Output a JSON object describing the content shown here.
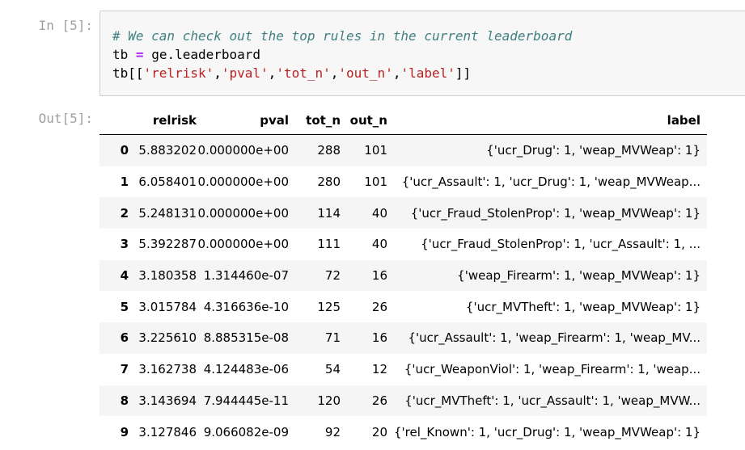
{
  "in_prompt": "In [5]:",
  "out_prompt": "Out[5]:",
  "code": {
    "comment": "# We can check out the top rules in the current leaderboard",
    "line2": {
      "var": "tb",
      "op": "=",
      "expr": "ge.leaderboard"
    },
    "line3": {
      "prefix": "tb[[",
      "s1": "'relrisk'",
      "s2": "'pval'",
      "s3": "'tot_n'",
      "s4": "'out_n'",
      "s5": "'label'",
      "comma": ",",
      "suffix": "]]"
    }
  },
  "table": {
    "columns": [
      "",
      "relrisk",
      "pval",
      "tot_n",
      "out_n",
      "label"
    ],
    "rows": [
      [
        "0",
        "5.883202",
        "0.000000e+00",
        "288",
        "101",
        "{'ucr_Drug': 1, 'weap_MVWeap': 1}"
      ],
      [
        "1",
        "6.058401",
        "0.000000e+00",
        "280",
        "101",
        "{'ucr_Assault': 1, 'ucr_Drug': 1, 'weap_MVWeap..."
      ],
      [
        "2",
        "5.248131",
        "0.000000e+00",
        "114",
        "40",
        "{'ucr_Fraud_StolenProp': 1, 'weap_MVWeap': 1}"
      ],
      [
        "3",
        "5.392287",
        "0.000000e+00",
        "111",
        "40",
        "{'ucr_Fraud_StolenProp': 1, 'ucr_Assault': 1, ..."
      ],
      [
        "4",
        "3.180358",
        "1.314460e-07",
        "72",
        "16",
        "{'weap_Firearm': 1, 'weap_MVWeap': 1}"
      ],
      [
        "5",
        "3.015784",
        "4.316636e-10",
        "125",
        "26",
        "{'ucr_MVTheft': 1, 'weap_MVWeap': 1}"
      ],
      [
        "6",
        "3.225610",
        "8.885315e-08",
        "71",
        "16",
        "{'ucr_Assault': 1, 'weap_Firearm': 1, 'weap_MV..."
      ],
      [
        "7",
        "3.162738",
        "4.124483e-06",
        "54",
        "12",
        "{'ucr_WeaponViol': 1, 'weap_Firearm': 1, 'weap..."
      ],
      [
        "8",
        "3.143694",
        "7.944445e-11",
        "120",
        "26",
        "{'ucr_MVTheft': 1, 'ucr_Assault': 1, 'weap_MVW..."
      ],
      [
        "9",
        "3.127846",
        "9.066082e-09",
        "92",
        "20",
        "{'rel_Known': 1, 'ucr_Drug': 1, 'weap_MVWeap': 1}"
      ]
    ]
  }
}
